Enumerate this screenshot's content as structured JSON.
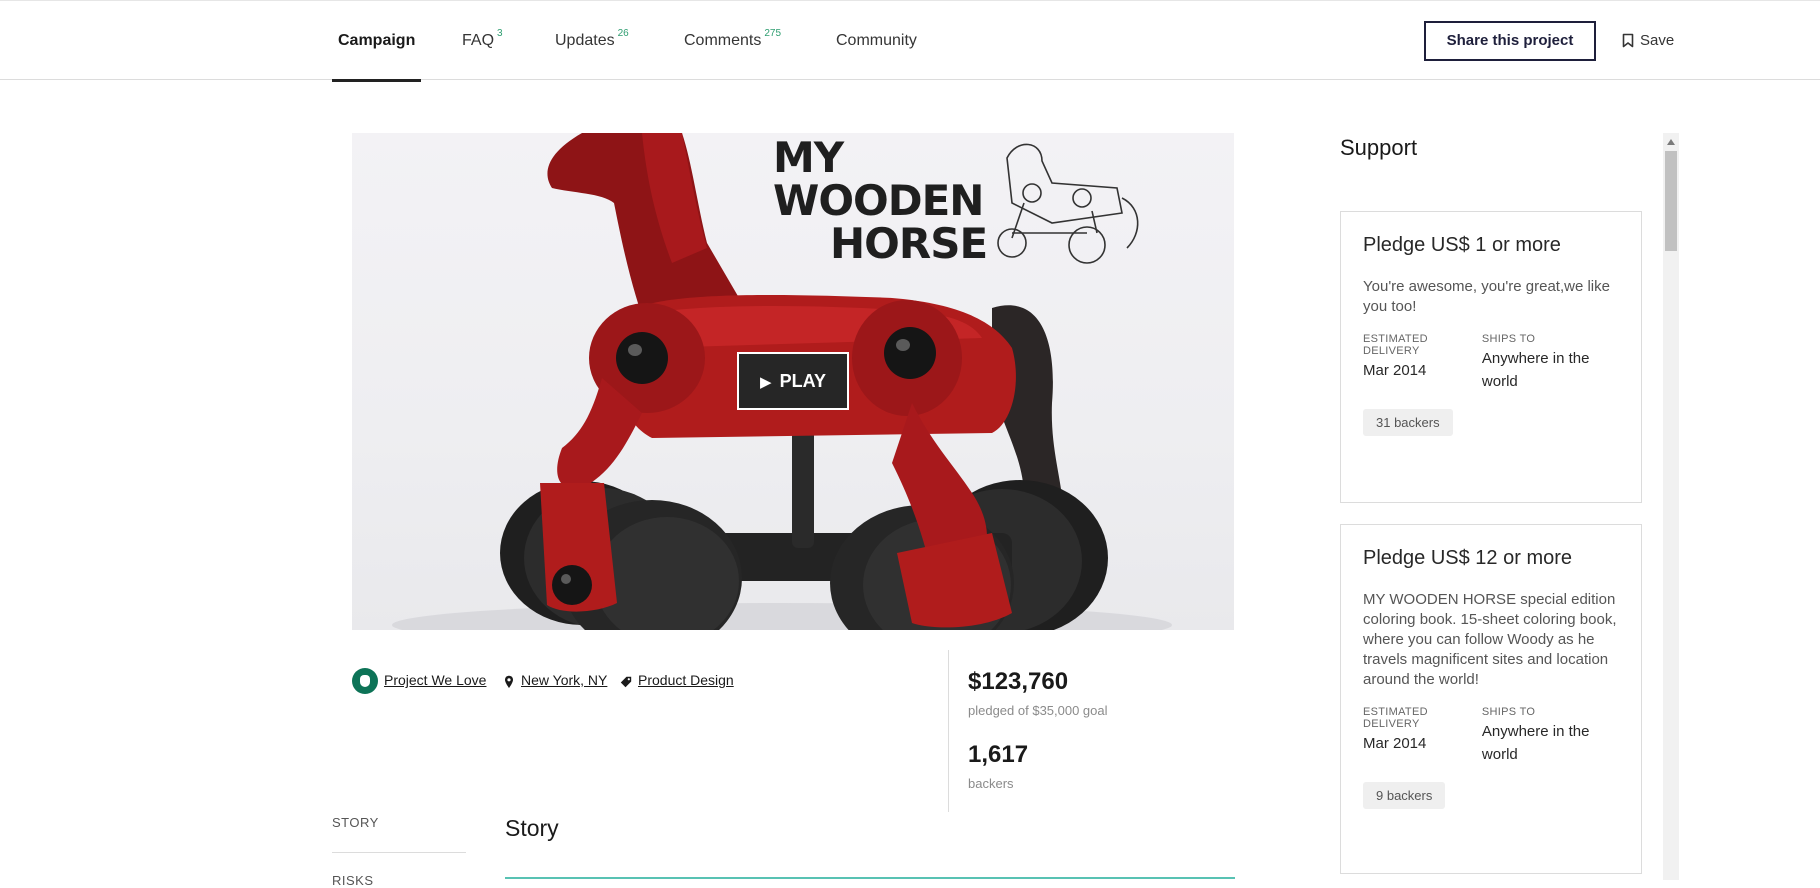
{
  "nav": {
    "tabs": [
      {
        "label": "Campaign",
        "count": ""
      },
      {
        "label": "FAQ",
        "count": "3"
      },
      {
        "label": "Updates",
        "count": "26"
      },
      {
        "label": "Comments",
        "count": "275"
      },
      {
        "label": "Community",
        "count": ""
      }
    ],
    "active_tab": "Campaign",
    "share_label": "Share this project",
    "save_label": "Save"
  },
  "hero": {
    "logo_line1": "MY",
    "logo_line2": "WOODEN",
    "logo_line3": "HORSE",
    "play_label": "PLAY"
  },
  "meta": {
    "badge": "Project We Love",
    "location": "New York, NY",
    "category": "Product Design"
  },
  "stats": {
    "pledged": "$123,760",
    "pledged_sub": "pledged of $35,000 goal",
    "backers": "1,617",
    "backers_sub": "backers"
  },
  "story": {
    "nav_story": "STORY",
    "nav_risks": "RISKS",
    "title": "Story"
  },
  "support": {
    "title": "Support",
    "rewards": [
      {
        "title": "Pledge US$ 1 or more",
        "description": "You're awesome, you're great,we like you too!",
        "delivery_label": "ESTIMATED DELIVERY",
        "delivery": "Mar 2014",
        "ships_label": "SHIPS TO",
        "ships": "Anywhere in the world",
        "backers": "31 backers"
      },
      {
        "title": "Pledge US$ 12 or more",
        "description": "MY WOODEN HORSE special edition coloring book. 15-sheet coloring book, where you can follow Woody as he travels magnificent sites and location around the world!",
        "delivery_label": "ESTIMATED DELIVERY",
        "delivery": "Mar 2014",
        "ships_label": "SHIPS TO",
        "ships": "Anywhere in the world",
        "backers": "9 backers"
      }
    ]
  },
  "colors": {
    "accent_green": "#2f9e71",
    "badge_green": "#0d7357",
    "share_border": "#1e1f3b",
    "story_rule": "#58c2b3",
    "horse_red": "#b01c1c"
  }
}
